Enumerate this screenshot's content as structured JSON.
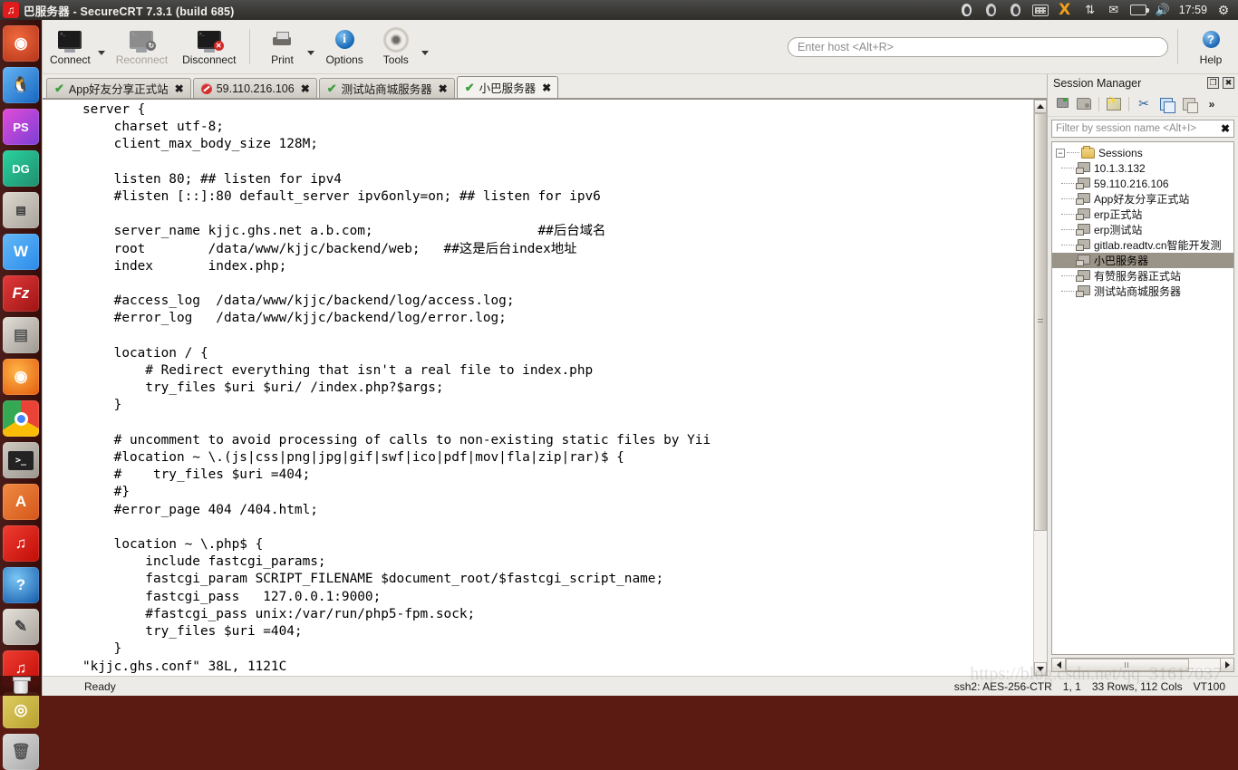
{
  "window": {
    "title": "巴服务器 - SecureCRT 7.3.1 (build 685)",
    "app_icon": "music-app-icon"
  },
  "top_panel": {
    "clock": "17:59",
    "tray_icons": [
      "penguin-red-icon",
      "penguin-icon",
      "penguin-icon",
      "keyboard-icon",
      "xmind-icon",
      "network-updown-icon",
      "mail-icon",
      "battery-icon",
      "volume-icon"
    ],
    "settings_icon": "gear-icon"
  },
  "launcher": {
    "items": [
      {
        "name": "ubuntu-dash",
        "glyph": "◉",
        "color": "#d24b2a",
        "pinned": false
      },
      {
        "name": "qq-penguin",
        "glyph": "🐧",
        "color": "#2f6fb8",
        "pinned": false
      },
      {
        "name": "phpstorm",
        "glyph": "PS",
        "color": "#b24ad0",
        "pinned": true
      },
      {
        "name": "datagrip",
        "glyph": "DG",
        "color": "#2fa37e",
        "pinned": true
      },
      {
        "name": "securecrt",
        "glyph": "▤",
        "color": "#b9b5ad",
        "pinned": true
      },
      {
        "name": "wps-writer",
        "glyph": "W",
        "color": "#2f9bf0",
        "pinned": false
      },
      {
        "name": "filezilla",
        "glyph": "Fz",
        "color": "#c0232a",
        "pinned": false
      },
      {
        "name": "file-manager",
        "glyph": "▤",
        "color": "#a9a49c",
        "pinned": false
      },
      {
        "name": "firefox",
        "glyph": "◉",
        "color": "#e8790f",
        "pinned": true
      },
      {
        "name": "chrome",
        "glyph": "◉",
        "color": "#4285f4",
        "pinned": true
      },
      {
        "name": "terminal",
        "glyph": ">_",
        "color": "#2b2b2b",
        "pinned": true
      },
      {
        "name": "ubuntu-software",
        "glyph": "A",
        "color": "#e4702a",
        "pinned": false
      },
      {
        "name": "netease-music",
        "glyph": "♫",
        "color": "#d81e06",
        "pinned": false
      },
      {
        "name": "help",
        "glyph": "?",
        "color": "#1b6fc2",
        "pinned": false
      },
      {
        "name": "text-editor",
        "glyph": "✎",
        "color": "#c9c5bd",
        "pinned": true
      },
      {
        "name": "netease-music-2",
        "glyph": "♫",
        "color": "#d81e06",
        "pinned": true
      },
      {
        "name": "wps-office",
        "glyph": "◎",
        "color": "#d9b738",
        "pinned": true
      },
      {
        "name": "trash",
        "glyph": "🗑",
        "color": "#bcbcbc",
        "pinned": false
      }
    ]
  },
  "toolbar": {
    "buttons": [
      {
        "label": "Connect",
        "icon": "monitor-connect-icon",
        "has_dropdown": true,
        "disabled": false
      },
      {
        "label": "Reconnect",
        "icon": "monitor-reconnect-icon",
        "has_dropdown": false,
        "disabled": true
      },
      {
        "label": "Disconnect",
        "icon": "monitor-disconnect-icon",
        "has_dropdown": false,
        "disabled": false
      },
      {
        "label": "Print",
        "icon": "printer-icon",
        "has_dropdown": true,
        "disabled": false
      },
      {
        "label": "Options",
        "icon": "info-icon",
        "has_dropdown": false,
        "disabled": false
      },
      {
        "label": "Tools",
        "icon": "gear-icon",
        "has_dropdown": true,
        "disabled": false
      }
    ],
    "host_placeholder": "Enter host <Alt+R>",
    "host_value": "",
    "help_label": "Help",
    "help_icon": "help-question-icon"
  },
  "tabs": [
    {
      "label": "App好友分享正式站",
      "status": "connected",
      "active": false
    },
    {
      "label": "59.110.216.106",
      "status": "disconnected",
      "active": false
    },
    {
      "label": "测试站商城服务器",
      "status": "connected",
      "active": false
    },
    {
      "label": "小巴服务器",
      "status": "connected",
      "active": true
    }
  ],
  "terminal": {
    "lines": [
      "server {",
      "    charset utf-8;",
      "    client_max_body_size 128M;",
      "",
      "    listen 80; ## listen for ipv4",
      "    #listen [::]:80 default_server ipv6only=on; ## listen for ipv6",
      "",
      "    server_name kjjc.ghs.net a.b.com;                     ##后台域名",
      "    root        /data/www/kjjc/backend/web;   ##这是后台index地址",
      "    index       index.php;",
      "",
      "    #access_log  /data/www/kjjc/backend/log/access.log;",
      "    #error_log   /data/www/kjjc/backend/log/error.log;",
      "",
      "    location / {",
      "        # Redirect everything that isn't a real file to index.php",
      "        try_files $uri $uri/ /index.php?$args;",
      "    }",
      "",
      "    # uncomment to avoid processing of calls to non-existing static files by Yii",
      "    #location ~ \\.(js|css|png|jpg|gif|swf|ico|pdf|mov|fla|zip|rar)$ {",
      "    #    try_files $uri =404;",
      "    #}",
      "    #error_page 404 /404.html;",
      "",
      "    location ~ \\.php$ {",
      "        include fastcgi_params;",
      "        fastcgi_param SCRIPT_FILENAME $document_root/$fastcgi_script_name;",
      "        fastcgi_pass   127.0.0.1:9000;",
      "        #fastcgi_pass unix:/var/run/php5-fpm.sock;",
      "        try_files $uri =404;",
      "    }",
      "\"kjjc.ghs.conf\" 38L, 1121C"
    ]
  },
  "session_manager": {
    "title": "Session Manager",
    "undock_icon": "undock-icon",
    "close_icon": "close-icon",
    "toolbar_icons": [
      "new-session-icon",
      "new-folder-icon",
      "session-wizard-icon",
      "cut-icon",
      "copy-icon",
      "paste-icon",
      "more-chevron-icon"
    ],
    "filter_placeholder": "Filter by session name <Alt+I>",
    "filter_value": "",
    "filter_clear_icon": "clear-x-icon",
    "tree": {
      "root_label": "Sessions",
      "expanded": true,
      "items": [
        {
          "label": "10.1.3.132",
          "selected": false
        },
        {
          "label": "59.110.216.106",
          "selected": false
        },
        {
          "label": "App好友分享正式站",
          "selected": false
        },
        {
          "label": "erp正式站",
          "selected": false
        },
        {
          "label": "erp测试站",
          "selected": false
        },
        {
          "label": "gitlab.readtv.cn智能开发测",
          "selected": false
        },
        {
          "label": "小巴服务器",
          "selected": true
        },
        {
          "label": "有赞服务器正式站",
          "selected": false
        },
        {
          "label": "测试站商城服务器",
          "selected": false
        }
      ]
    }
  },
  "status_bar": {
    "icon": "trash-icon",
    "message": "Ready",
    "cipher": "ssh2: AES-256-CTR",
    "cursor": "1, 1",
    "size": "33 Rows, 112 Cols",
    "emulation": "VT100"
  },
  "watermark": "https://blog.csdn.net/qq_31617037",
  "colors": {
    "panel_bg": "#edebe7",
    "launcher_bg": "#3d0f0c",
    "terminal_bg": "#ffffff",
    "terminal_fg": "#000000",
    "selection_bg": "#9a9387"
  }
}
